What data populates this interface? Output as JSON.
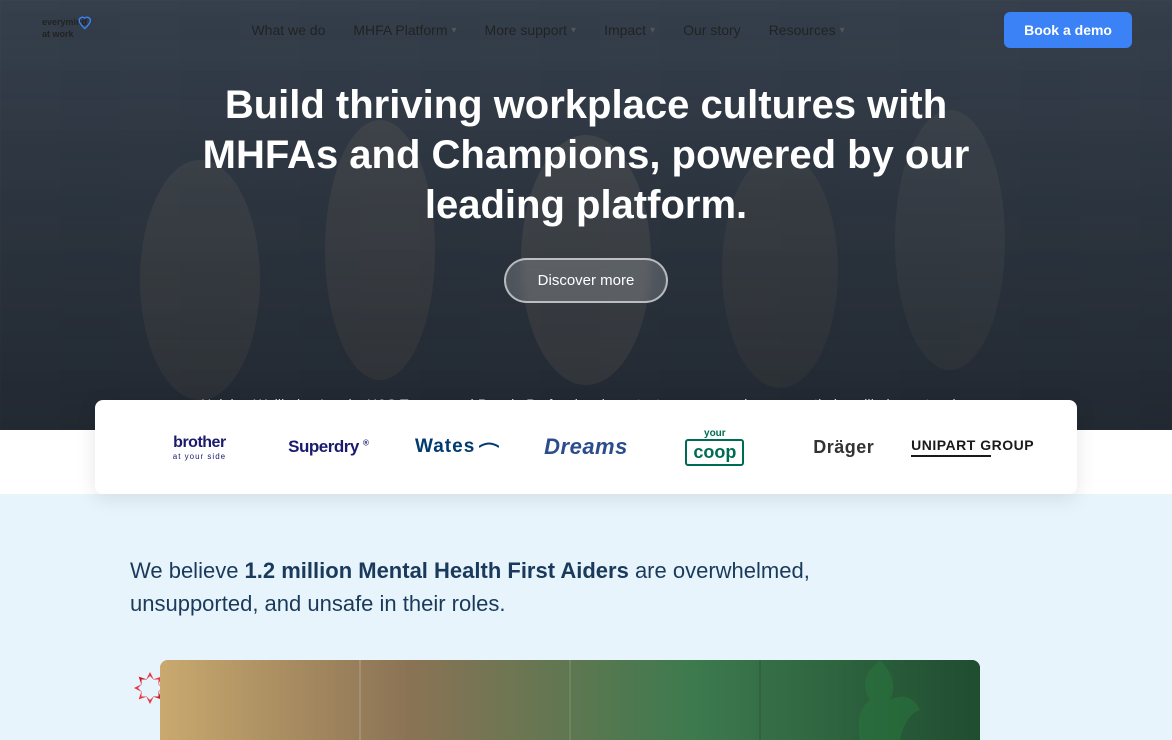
{
  "nav": {
    "logo_text": "everymind\nat work",
    "links": [
      {
        "label": "What we do",
        "has_dropdown": false
      },
      {
        "label": "MHFA Platform",
        "has_dropdown": true
      },
      {
        "label": "More support",
        "has_dropdown": true
      },
      {
        "label": "Impact",
        "has_dropdown": true
      },
      {
        "label": "Our story",
        "has_dropdown": false
      },
      {
        "label": "Resources",
        "has_dropdown": true
      }
    ],
    "cta_label": "Book a demo"
  },
  "hero": {
    "title": "Build thriving workplace cultures with MHFAs and Champions, powered by our leading platform.",
    "cta_label": "Discover more",
    "subtitle": "Helping Wellbeing Leads, H&S Teams, and People Professionals protect, engage, and empower their wellbeing networks."
  },
  "logos": [
    {
      "id": "brother",
      "text": "brother",
      "subtext": "at your side"
    },
    {
      "id": "superdry",
      "text": "Superdry"
    },
    {
      "id": "wates",
      "text": "Wates"
    },
    {
      "id": "dreams",
      "text": "Dreams"
    },
    {
      "id": "yourcoop",
      "text": "your coop"
    },
    {
      "id": "drager",
      "text": "Dräger"
    },
    {
      "id": "unipart",
      "text": "UNIPART GROUP"
    }
  ],
  "belief_section": {
    "text_html": "We believe <strong>1.2 million Mental Health First Aiders</strong> are overwhelmed, unsupported, and unsafe in their roles."
  }
}
